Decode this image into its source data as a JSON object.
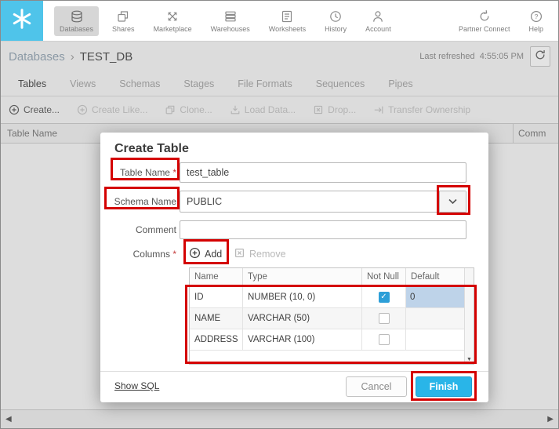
{
  "colors": {
    "accent": "#29B5E8",
    "logo_bg": "#4FC4EA",
    "annotation_red": "#D40000",
    "checkbox_checked": "#2D9FD8",
    "selected_cell_bg": "#BED3E9"
  },
  "icons": {
    "logo": "snowflake",
    "nav": [
      "database",
      "shares-copy",
      "marketplace-arrows",
      "warehouse-stack",
      "worksheet-document",
      "history-clock",
      "person",
      "partner-connect-circular-arrow",
      "help-question"
    ],
    "refresh": "circular-arrow",
    "create": "circle-plus",
    "add": "circle-plus",
    "remove": "x-square",
    "dropdown": "chevron-down",
    "scroll_down": "down-triangle",
    "scroll_left": "left-triangle",
    "scroll_right": "right-triangle"
  },
  "nav": {
    "items": [
      {
        "label": "Databases",
        "active": true
      },
      {
        "label": "Shares"
      },
      {
        "label": "Marketplace"
      },
      {
        "label": "Warehouses"
      },
      {
        "label": "Worksheets"
      },
      {
        "label": "History"
      },
      {
        "label": "Account"
      },
      {
        "label": "Partner Connect"
      },
      {
        "label": "Help"
      }
    ]
  },
  "breadcrumb": {
    "root": "Databases",
    "separator": "›",
    "current": "TEST_DB"
  },
  "refresh_bar": {
    "label": "Last refreshed",
    "time": "4:55:05 PM"
  },
  "tabs": [
    {
      "label": "Tables",
      "active": true
    },
    {
      "label": "Views"
    },
    {
      "label": "Schemas"
    },
    {
      "label": "Stages"
    },
    {
      "label": "File Formats"
    },
    {
      "label": "Sequences"
    },
    {
      "label": "Pipes"
    }
  ],
  "toolbar": [
    {
      "label": "Create...",
      "enabled": true
    },
    {
      "label": "Create Like...",
      "enabled": false
    },
    {
      "label": "Clone...",
      "enabled": false
    },
    {
      "label": "Load Data...",
      "enabled": false
    },
    {
      "label": "Drop...",
      "enabled": false
    },
    {
      "label": "Transfer Ownership",
      "enabled": false
    }
  ],
  "grid": {
    "columns": [
      "Table Name",
      "Comm"
    ]
  },
  "dialog": {
    "title": "Create Table",
    "table_name": {
      "label": "Table Name",
      "required": "*",
      "value": "test_table"
    },
    "schema_name": {
      "label": "Schema Name",
      "value": "PUBLIC"
    },
    "comment": {
      "label": "Comment",
      "value": ""
    },
    "columns_section": {
      "label": "Columns",
      "required": "*",
      "add": "Add",
      "remove": "Remove"
    },
    "columns_table": {
      "headers": [
        "Name",
        "Type",
        "Not Null",
        "Default"
      ],
      "rows": [
        {
          "name": "ID",
          "type": "NUMBER (10, 0)",
          "not_null": true,
          "default": "0"
        },
        {
          "name": "NAME",
          "type": "VARCHAR (50)",
          "not_null": false,
          "default": ""
        },
        {
          "name": "ADDRESS",
          "type": "VARCHAR (100)",
          "not_null": false,
          "default": ""
        }
      ]
    },
    "footer": {
      "show_sql": "Show SQL",
      "cancel": "Cancel",
      "finish": "Finish"
    }
  }
}
